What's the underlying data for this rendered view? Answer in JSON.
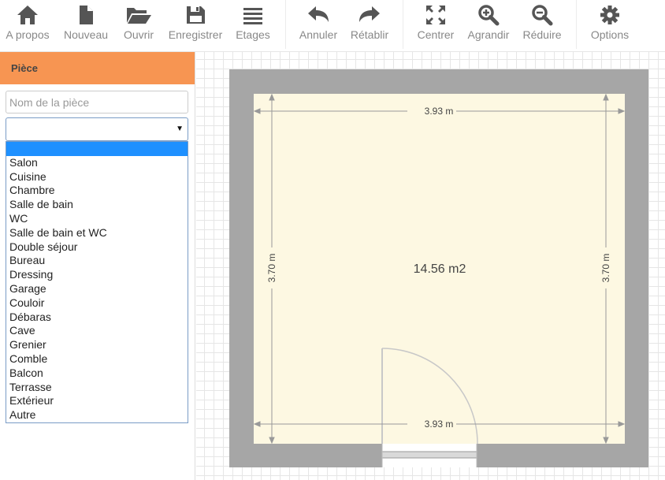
{
  "toolbar": {
    "items": [
      {
        "label": "A propos",
        "icon": "home-icon"
      },
      {
        "label": "Nouveau",
        "icon": "file-icon"
      },
      {
        "label": "Ouvrir",
        "icon": "folder-open-icon"
      },
      {
        "label": "Enregistrer",
        "icon": "save-icon"
      },
      {
        "label": "Etages",
        "icon": "menu-icon"
      },
      {
        "label": "Annuler",
        "icon": "undo-icon"
      },
      {
        "label": "Rétablir",
        "icon": "redo-icon"
      },
      {
        "label": "Centrer",
        "icon": "expand-icon"
      },
      {
        "label": "Agrandir",
        "icon": "zoom-in-icon"
      },
      {
        "label": "Réduire",
        "icon": "zoom-out-icon"
      },
      {
        "label": "Options",
        "icon": "gear-icon"
      }
    ],
    "icon_color": "#555555",
    "label_color": "#888888"
  },
  "panel": {
    "title": "Pièce",
    "header_color": "#f79552",
    "name_placeholder": "Nom de la pièce",
    "name_value": "",
    "select_value": "",
    "options": [
      "",
      "Salon",
      "Cuisine",
      "Chambre",
      "Salle de bain",
      "WC",
      "Salle de bain et WC",
      "Double séjour",
      "Bureau",
      "Dressing",
      "Garage",
      "Couloir",
      "Débaras",
      "Cave",
      "Grenier",
      "Comble",
      "Balcon",
      "Terrasse",
      "Extérieur",
      "Autre"
    ],
    "highlight_color": "#1e90ff"
  },
  "plan": {
    "width_top": "3.93 m",
    "width_bottom": "3.93 m",
    "height_left": "3.70 m",
    "height_right": "3.70 m",
    "area": "14.56 m2",
    "wall_color": "#a6a6a6",
    "floor_color": "#fdf8e2"
  }
}
